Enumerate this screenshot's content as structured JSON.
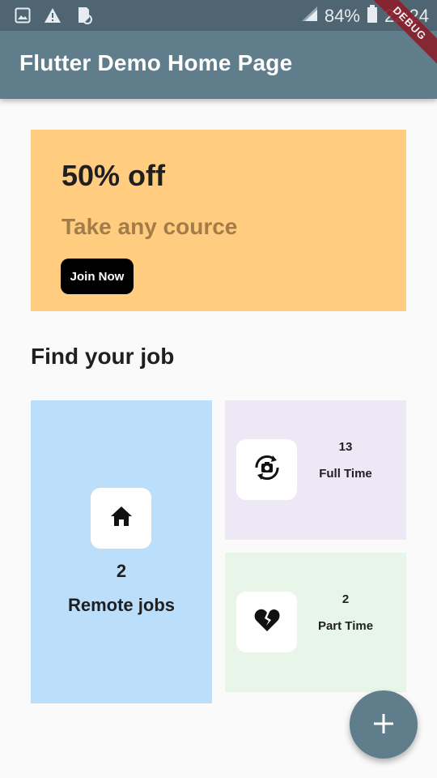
{
  "status_bar": {
    "battery_text": "84%",
    "time": "22:24",
    "icons": [
      "image-icon",
      "warning-icon",
      "sd-card-sync-icon",
      "signal-icon",
      "battery-icon"
    ]
  },
  "app_bar": {
    "title": "Flutter Demo Home Page",
    "debug_label": "DEBUG"
  },
  "promo": {
    "title": "50% off",
    "subtitle": "Take any cource",
    "button_label": "Join Now"
  },
  "section_title": "Find your job",
  "job_cards": {
    "remote": {
      "count": "2",
      "label": "Remote jobs",
      "icon": "home-icon"
    },
    "full_time": {
      "count": "13",
      "label": "Full Time",
      "icon": "camera-rotate-icon"
    },
    "part_time": {
      "count": "2",
      "label": "Part Time",
      "icon": "broken-heart-icon"
    }
  },
  "fab": {
    "icon": "plus-icon"
  },
  "colors": {
    "app_bar": "#607d8b",
    "status_bar": "#4f6672",
    "promo_bg": "#ffcc80",
    "remote_bg": "#bbdefb",
    "full_time_bg": "#ede7f6",
    "part_time_bg": "#e8f5e9"
  }
}
